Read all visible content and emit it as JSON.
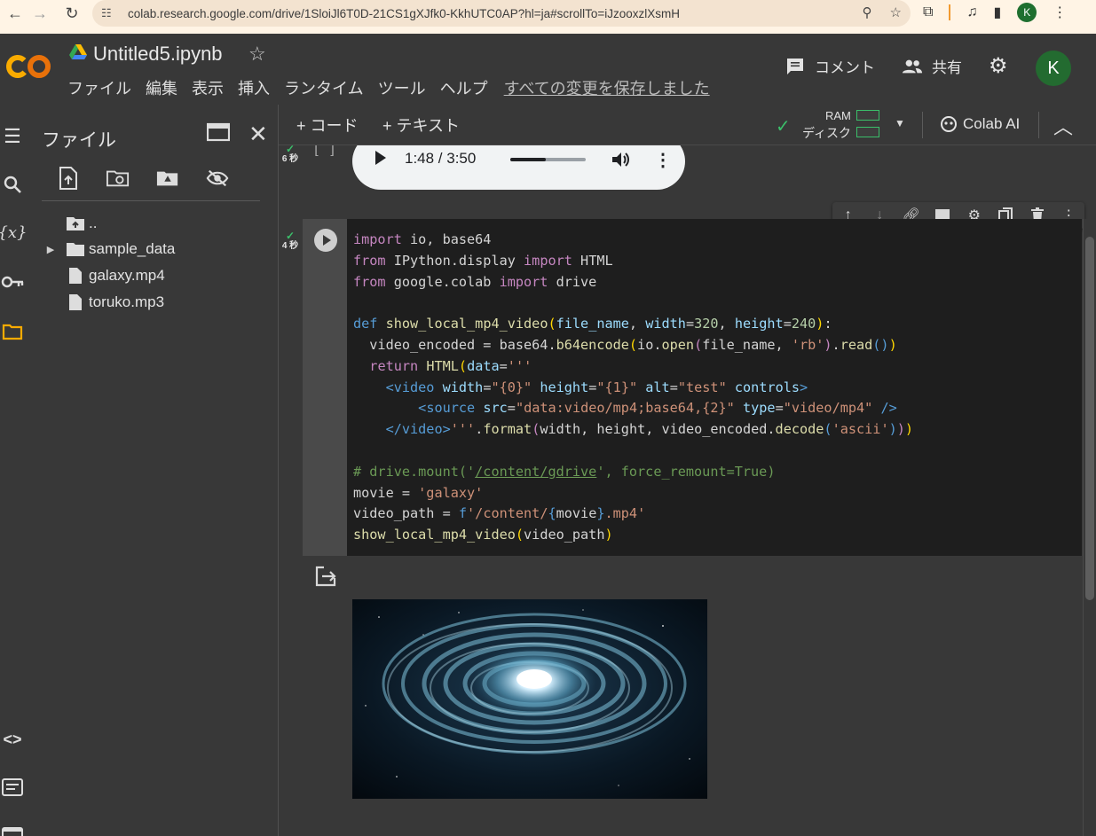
{
  "browser": {
    "back_icon": "arrow-left-icon",
    "forward_icon": "arrow-right-icon",
    "reload_icon": "reload-icon",
    "url": "colab.research.google.com/drive/1SloiJl6T0D-21CS1gXJfk0-KkhUTC0AP?hl=ja#scrollTo=iJzooxzlXsmH",
    "profile_initial": "K"
  },
  "header": {
    "notebook_title": "Untitled5.ipynb",
    "menu": [
      "ファイル",
      "編集",
      "表示",
      "挿入",
      "ランタイム",
      "ツール",
      "ヘルプ"
    ],
    "saved_status": "すべての変更を保存しました",
    "comment_label": "コメント",
    "share_label": "共有",
    "avatar_initial": "K"
  },
  "file_panel": {
    "title": "ファイル",
    "items": [
      {
        "name": "..",
        "type": "parent"
      },
      {
        "name": "sample_data",
        "type": "folder"
      },
      {
        "name": "galaxy.mp4",
        "type": "file"
      },
      {
        "name": "toruko.mp3",
        "type": "file"
      }
    ]
  },
  "toolbar": {
    "add_code": "+ コード",
    "add_text": "+ テキスト",
    "ram_label": "RAM",
    "disk_label": "ディスク",
    "colab_ai": "Colab AI"
  },
  "prev_cell": {
    "exec_time": "6 秒",
    "bracket": "[ ]",
    "audio": {
      "current": "1:48",
      "total": "3:50",
      "time_text": "1:48 / 3:50",
      "progress": 0.47
    }
  },
  "code_cell": {
    "exec_time": "4 秒"
  },
  "colors": {
    "accent_green": "#3bbf6a",
    "active_orange": "#f9ab00",
    "code_bg": "#1e1e1e",
    "panel_bg": "#383838"
  }
}
